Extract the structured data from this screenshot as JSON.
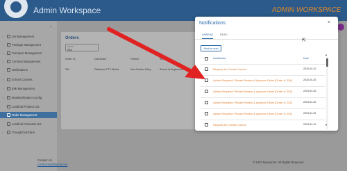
{
  "header": {
    "title": "Admin Workspace",
    "right_label": "ADMIN WORKSPACE"
  },
  "sidebar": {
    "items": [
      {
        "label": "List Management",
        "active": false
      },
      {
        "label": "Package Management",
        "active": false
      },
      {
        "label": "Transport Management",
        "active": false
      },
      {
        "label": "Contract Management",
        "active": false
      },
      {
        "label": "Notifications",
        "active": false
      },
      {
        "label": "School Courses",
        "active": false
      },
      {
        "label": "EMI Management",
        "active": false
      },
      {
        "label": "MostNotification Config",
        "active": false
      },
      {
        "label": "Landlord Product List",
        "active": false
      },
      {
        "label": "Order Management",
        "active": true
      },
      {
        "label": "Landlord Activation Dis",
        "active": false
      },
      {
        "label": "ThoughtOnOnline",
        "active": false
      }
    ]
  },
  "orders": {
    "title": "Orders",
    "field_label": "Search",
    "field_value": "254",
    "columns": [
      "Order ID",
      "Distributor",
      "Partner",
      "School"
    ],
    "row": [
      "254",
      "Distributor PTY Media",
      "New Partner 54/sp",
      "School of Engineers M"
    ]
  },
  "modal": {
    "title": "Notifications",
    "tabs": [
      "UNREAD",
      "READ"
    ],
    "mark_read_label": "Mark as read",
    "columns": {
      "notification": "Notification",
      "date": "Date"
    },
    "rows": [
      {
        "text": "Request for Create Course",
        "date": "2023-04-10"
      },
      {
        "text": "Action Required: Please Review & Approve Order [Order #: 254]",
        "date": "2023-04-25"
      },
      {
        "text": "Action Required: Please Review & Approve Order [Order #: 253]",
        "date": "2023-04-25"
      },
      {
        "text": "Action Required: Please Review & Approve Order [Order #: 252]",
        "date": "2023-04-25"
      },
      {
        "text": "Action Required: Please Review & Approve Order [Order #: 251]",
        "date": "2023-04-25"
      },
      {
        "text": "Request for Create Course",
        "date": "2023-04-10"
      }
    ]
  },
  "footer": {
    "contact_label": "Contact Us",
    "contact_link": "contactme@learner.net",
    "copyright": "© 2023 PyNearner. All Rights Reserved"
  },
  "icons": {
    "close": "close-icon",
    "cursor": "cursor-icon",
    "checkbox": "checkbox-icon"
  },
  "colors": {
    "header": "#2c5a8a",
    "accent": "#2c6aa8",
    "notification_text": "#e07a2a",
    "arrow": "#e02222"
  }
}
